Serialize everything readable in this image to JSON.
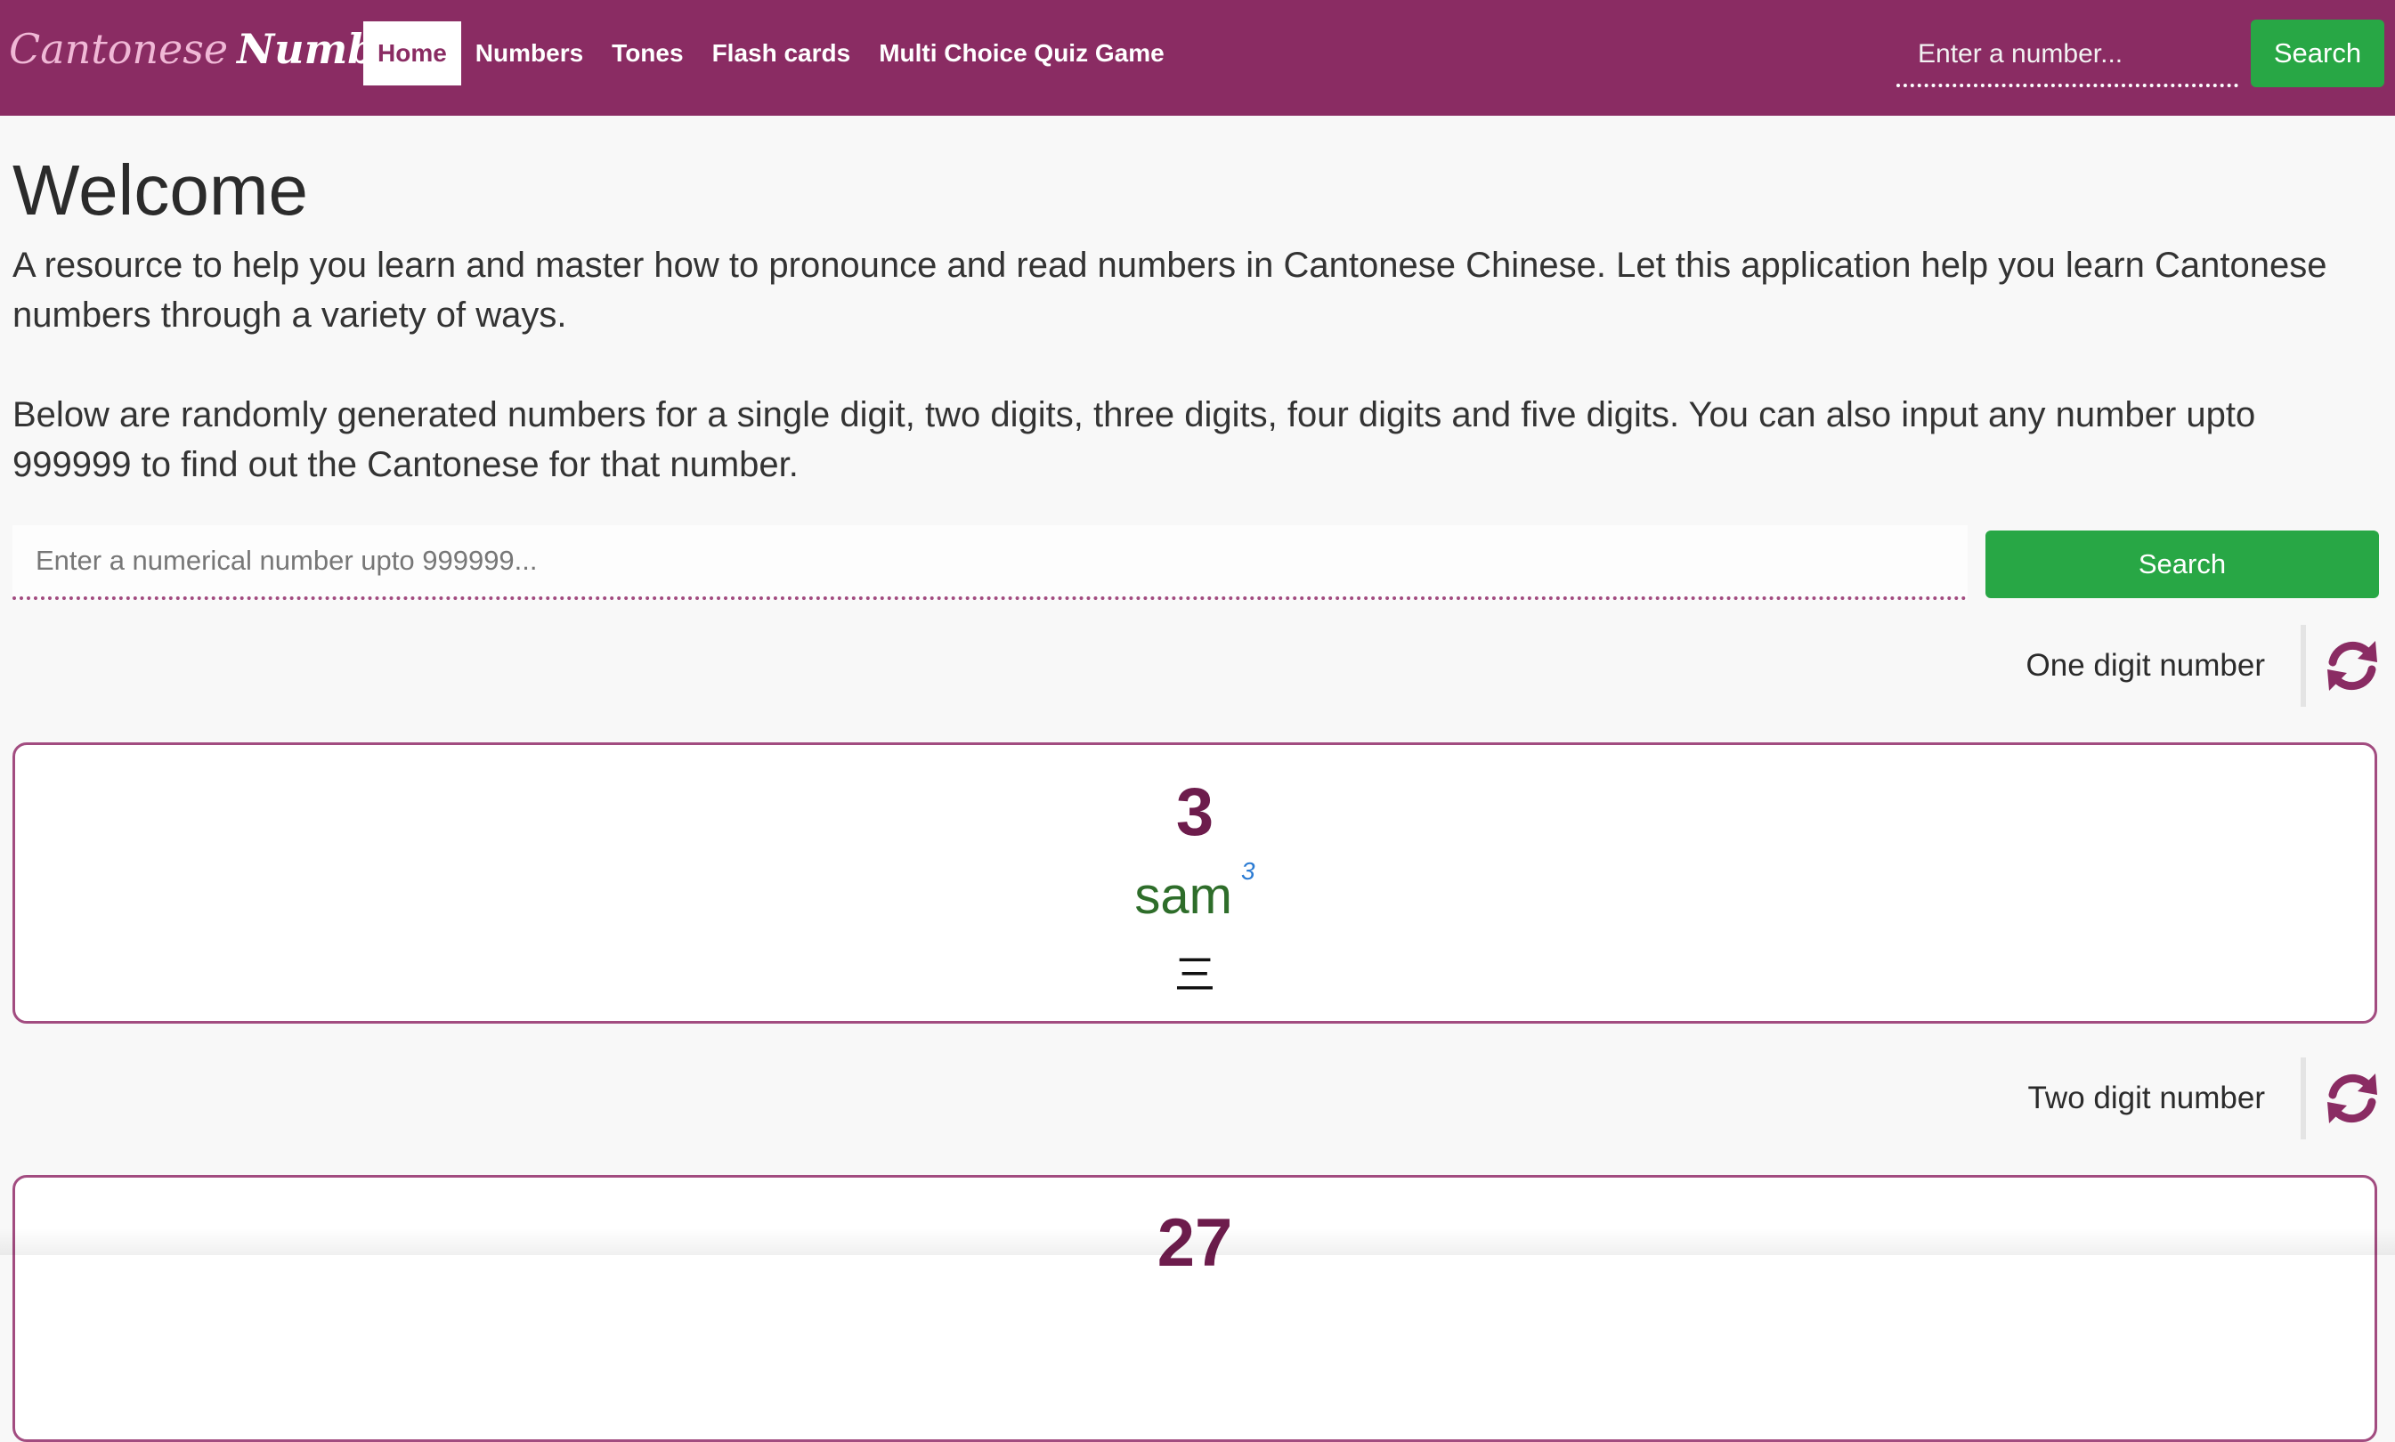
{
  "header": {
    "brand_part1": "Cantonese",
    "brand_part2": "Numbers",
    "nav": [
      {
        "label": "Home",
        "active": true
      },
      {
        "label": "Numbers",
        "active": false
      },
      {
        "label": "Tones",
        "active": false
      },
      {
        "label": "Flash cards",
        "active": false
      },
      {
        "label": "Multi Choice Quiz Game",
        "active": false
      }
    ],
    "search_placeholder": "Enter a number...",
    "search_button": "Search"
  },
  "main": {
    "title": "Welcome",
    "intro": "A resource to help you learn and master how to pronounce and read numbers in Cantonese Chinese. Let this application help you learn Cantonese numbers through a variety of ways.",
    "intro2": "Below are randomly generated numbers for a single digit, two digits, three digits, four digits and five digits. You can also input any number upto 999999 to find out the Cantonese for that number.",
    "search_placeholder": "Enter a numerical number upto 999999...",
    "search_button": "Search",
    "sections": [
      {
        "label": "One digit number",
        "number": "3",
        "romanization": "sam",
        "tone": "3",
        "chinese": "三"
      },
      {
        "label": "Two digit number",
        "number": "27"
      }
    ]
  },
  "colors": {
    "brand": "#8a2c63",
    "accent_green": "#28a745",
    "number_color": "#6d1c4c",
    "romanization_color": "#2e6d2a",
    "tone_color": "#2b7bd3"
  },
  "icons": {
    "refresh": "refresh-icon"
  }
}
